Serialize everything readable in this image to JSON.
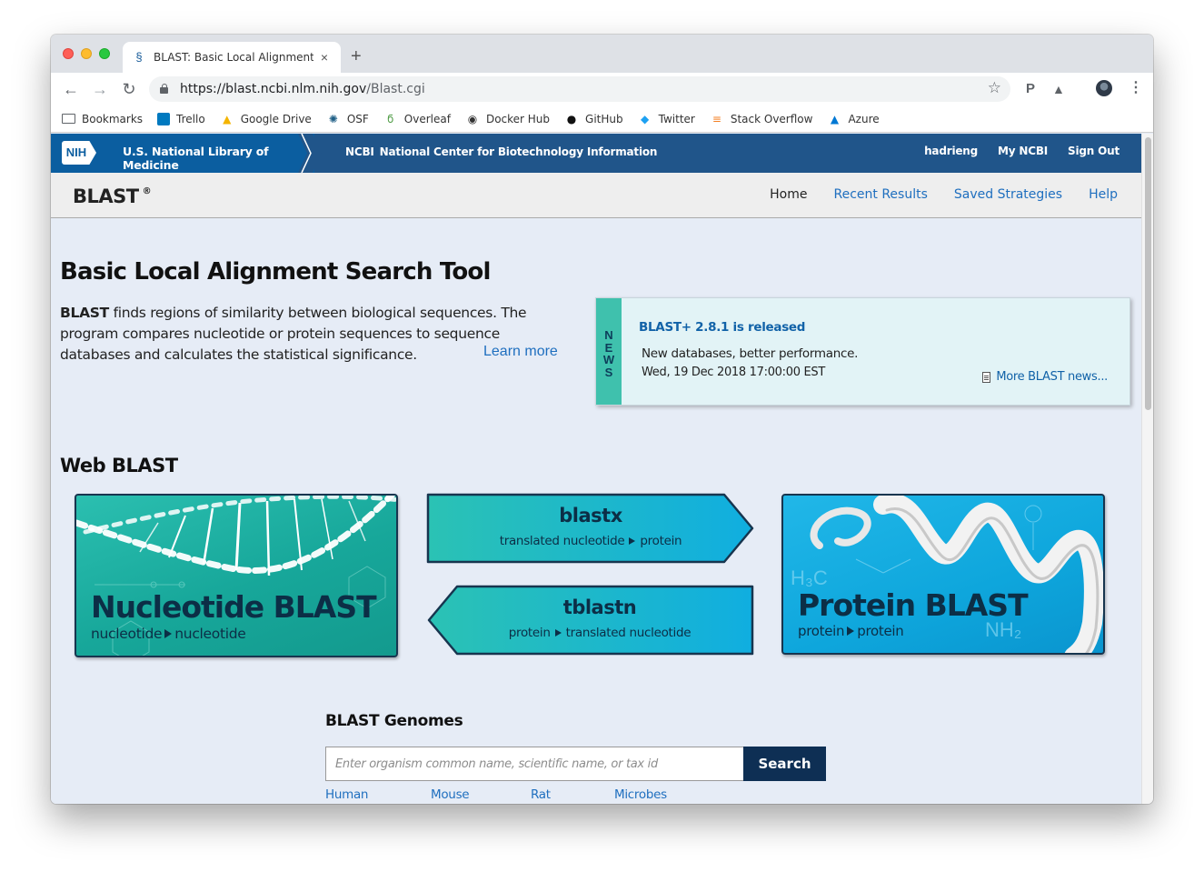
{
  "browser": {
    "tab_title": "BLAST: Basic Local Alignment",
    "new_tab_label": "+",
    "url_host": "https://blast.ncbi.nlm.nih.gov",
    "url_path": "/Blast.cgi",
    "bookmarks": [
      {
        "label": "Bookmarks",
        "icon": "folder-icon",
        "color": "#5f6368"
      },
      {
        "label": "Trello",
        "icon": "trello-icon",
        "color": "#0079bf"
      },
      {
        "label": "Google Drive",
        "icon": "google-drive-icon",
        "color": "#f4b400"
      },
      {
        "label": "OSF",
        "icon": "osf-icon",
        "color": "#1f5f86"
      },
      {
        "label": "Overleaf",
        "icon": "overleaf-icon",
        "color": "#4f9c45"
      },
      {
        "label": "Docker Hub",
        "icon": "docker-icon",
        "color": "#333333"
      },
      {
        "label": "GitHub",
        "icon": "github-icon",
        "color": "#111111"
      },
      {
        "label": "Twitter",
        "icon": "twitter-icon",
        "color": "#1da1f2"
      },
      {
        "label": "Stack Overflow",
        "icon": "stackoverflow-icon",
        "color": "#f48024"
      },
      {
        "label": "Azure",
        "icon": "azure-icon",
        "color": "#0078d4"
      }
    ]
  },
  "ncbi_bar": {
    "nih_logo": "NIH",
    "nlm": "U.S. National Library of Medicine",
    "ncbi_abbr": "NCBI",
    "ncbi_full": "National Center for Biotechnology Information",
    "user": "hadrieng",
    "my_ncbi": "My NCBI",
    "sign_out": "Sign Out",
    "colors": {
      "bar": "#20558a",
      "nlm": "#0b5ea0"
    }
  },
  "blast_header": {
    "brand": "BLAST",
    "trademark": "®",
    "nav": {
      "home": "Home",
      "recent": "Recent Results",
      "saved": "Saved Strategies",
      "help": "Help"
    }
  },
  "intro": {
    "title": "Basic Local Alignment Search Tool",
    "lead": "BLAST",
    "text": " finds regions of similarity between biological sequences. The program compares nucleotide or protein sequences to sequence databases and calculates the statistical significance.",
    "learn_more": "Learn more"
  },
  "news": {
    "tab_letters": [
      "N",
      "E",
      "W",
      "S"
    ],
    "headline": "BLAST+ 2.8.1 is released",
    "line1": "New databases, better performance.",
    "line2": "Wed, 19 Dec 2018 17:00:00 EST",
    "more": "More BLAST news..."
  },
  "web_blast": {
    "title": "Web BLAST",
    "nucleotide": {
      "title": "Nucleotide BLAST",
      "from": "nucleotide",
      "to": "nucleotide"
    },
    "blastx": {
      "title": "blastx",
      "from": "translated nucleotide",
      "to": "protein"
    },
    "tblastn": {
      "title": "tblastn",
      "from": "protein",
      "to": "translated nucleotide"
    },
    "protein": {
      "title": "Protein BLAST",
      "from": "protein",
      "to": "protein"
    }
  },
  "genomes": {
    "title": "BLAST Genomes",
    "placeholder": "Enter organism common name, scientific name, or tax id",
    "search_label": "Search",
    "links": [
      "Human",
      "Mouse",
      "Rat",
      "Microbes"
    ]
  }
}
